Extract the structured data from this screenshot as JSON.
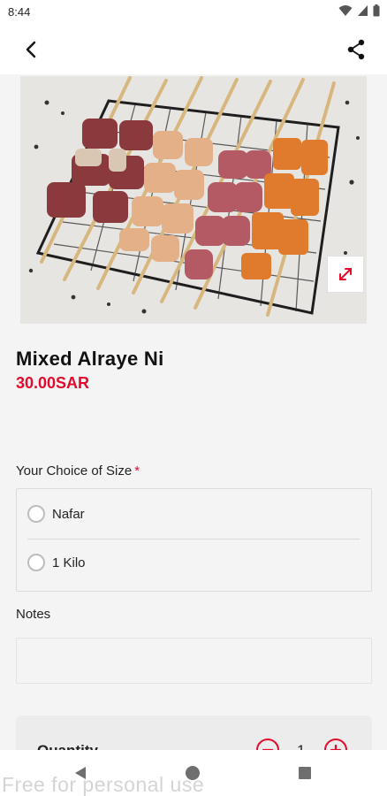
{
  "status_bar": {
    "time": "8:44",
    "icons": [
      "wifi-icon",
      "signal-icon",
      "battery-icon"
    ]
  },
  "app_bar": {
    "back_icon": "back-arrow-icon",
    "share_icon": "share-icon"
  },
  "product": {
    "name": "Mixed Alraye Ni",
    "price": "30.00SAR",
    "image": "mixed-skewers-photo",
    "expand_icon": "expand-icon"
  },
  "size_choice": {
    "label": "Your Choice of Size",
    "required_mark": "*",
    "options": [
      {
        "label": "Nafar",
        "selected": false
      },
      {
        "label": "1 Kilo",
        "selected": false
      }
    ]
  },
  "notes": {
    "label": "Notes",
    "value": "",
    "placeholder": ""
  },
  "quantity": {
    "label": "Quantity",
    "value": "1"
  },
  "nav": {
    "icons": [
      "nav-back-icon",
      "nav-home-icon",
      "nav-recents-icon"
    ]
  },
  "watermark": "Free for personal use",
  "colors": {
    "accent": "#e30b2c",
    "background": "#f4f4f5",
    "surface": "#ffffff"
  }
}
